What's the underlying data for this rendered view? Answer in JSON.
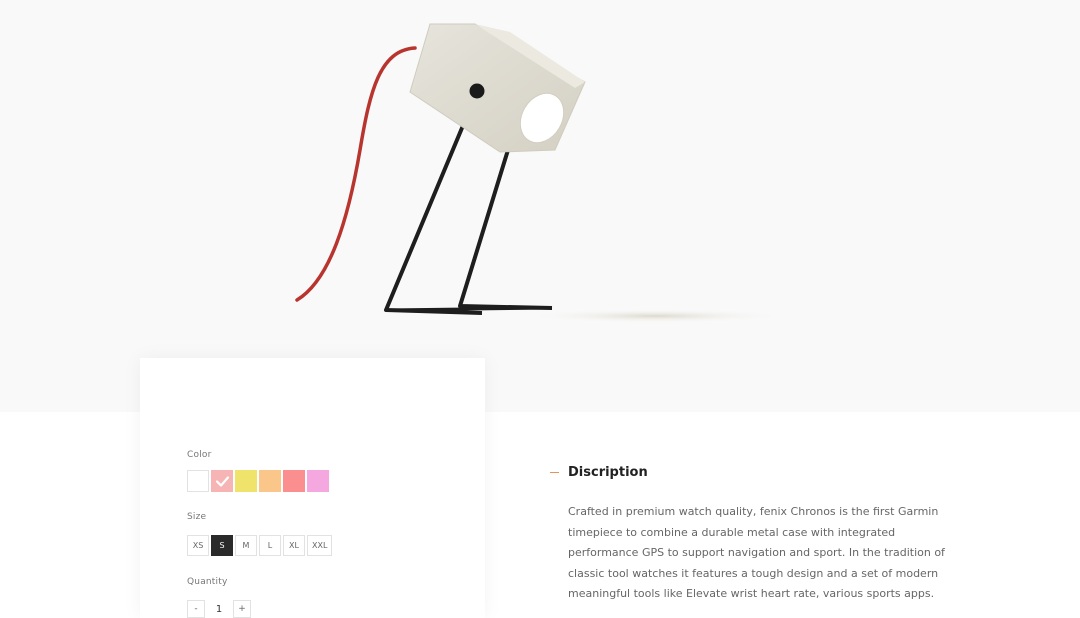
{
  "options": {
    "color_label": "Color",
    "colors": [
      "#ffffff",
      "#f7b4b4",
      "#f0e36b",
      "#fbc68a",
      "#fb8e8e",
      "#f5a7e0"
    ],
    "selected_color_index": 1,
    "size_label": "Size",
    "sizes": [
      "XS",
      "S",
      "M",
      "L",
      "XL",
      "XXL"
    ],
    "selected_size": "S",
    "quantity_label": "Quantity",
    "quantity_value": "1",
    "minus": "-",
    "plus": "+"
  },
  "description": {
    "title": "Discription",
    "accent_color": "#e3935b",
    "text": "Crafted in premium watch quality, fenix Chronos is the first Garmin timepiece to combine a durable metal case with integrated performance GPS to support navigation and sport. In the tradition of classic tool watches it features a tough design and a set of modern meaningful tools like Elevate wrist heart rate, various sports apps."
  }
}
